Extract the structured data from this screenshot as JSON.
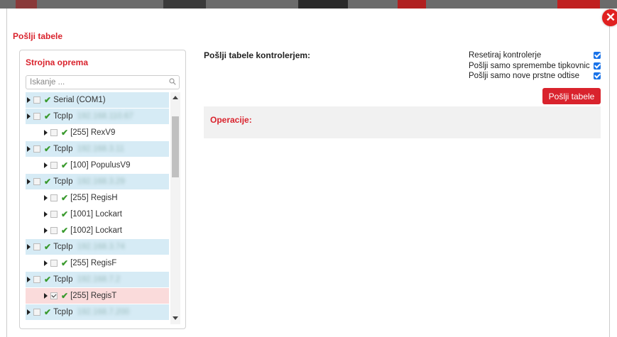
{
  "dialog": {
    "title": "Pošlji tabele",
    "close_icon": "close-icon"
  },
  "hardware": {
    "title": "Strojna oprema",
    "search_placeholder": "Iskanje ...",
    "items": [
      {
        "label": "Serial (COM1)",
        "level": 0,
        "style": "hl",
        "checked": false,
        "blur": ""
      },
      {
        "label": "TcpIp",
        "level": 0,
        "style": "hl",
        "checked": false,
        "blur": "192.168.110.67"
      },
      {
        "label": "[255] RexV9",
        "level": 1,
        "style": "",
        "checked": false,
        "blur": ""
      },
      {
        "label": "TcpIp",
        "level": 0,
        "style": "hl",
        "checked": false,
        "blur": "192.168.3.11"
      },
      {
        "label": "[100] PopulusV9",
        "level": 1,
        "style": "",
        "checked": false,
        "blur": ""
      },
      {
        "label": "TcpIp",
        "level": 0,
        "style": "hl",
        "checked": false,
        "blur": "192.168.3.29"
      },
      {
        "label": "[255] RegisH",
        "level": 1,
        "style": "",
        "checked": false,
        "blur": ""
      },
      {
        "label": "[1001] Lockart",
        "level": 1,
        "style": "",
        "checked": false,
        "blur": ""
      },
      {
        "label": "[1002] Lockart",
        "level": 1,
        "style": "",
        "checked": false,
        "blur": ""
      },
      {
        "label": "TcpIp",
        "level": 0,
        "style": "hl",
        "checked": false,
        "blur": "192.168.3.74"
      },
      {
        "label": "[255] RegisF",
        "level": 1,
        "style": "",
        "checked": false,
        "blur": ""
      },
      {
        "label": "TcpIp",
        "level": 0,
        "style": "hl",
        "checked": false,
        "blur": "192.168.7.2"
      },
      {
        "label": "[255] RegisT",
        "level": 1,
        "style": "sel",
        "checked": true,
        "blur": ""
      },
      {
        "label": "TcpIp",
        "level": 0,
        "style": "hl",
        "checked": false,
        "blur": "192.168.7.200"
      }
    ]
  },
  "send": {
    "label": "Pošlji tabele kontrolerjem:",
    "options": [
      {
        "label": "Resetiraj kontrolerje",
        "checked": true
      },
      {
        "label": "Pošlji samo spremembe tipkovnic",
        "checked": true
      },
      {
        "label": "Pošlji samo nove prstne odtise",
        "checked": true
      }
    ],
    "button_label": "Pošlji tabele",
    "operations_label": "Operacije:"
  },
  "colors": {
    "accent": "#d9232d",
    "row_highlight": "#d6ebf5",
    "row_selected": "#fadbdb",
    "check_green": "#3a9a2e",
    "checkbox_blue": "#1a73e8"
  }
}
